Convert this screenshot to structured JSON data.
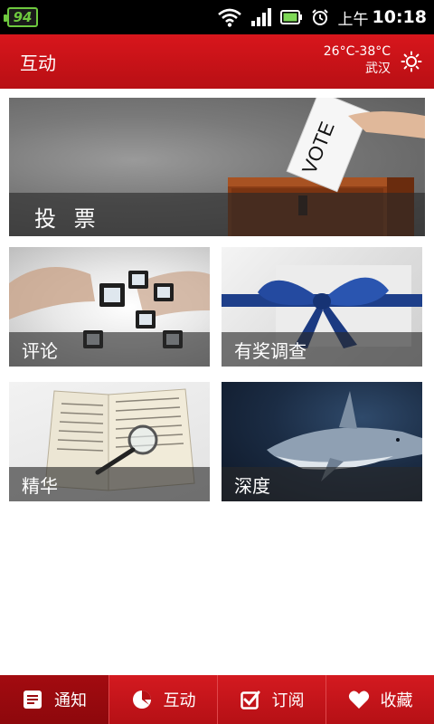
{
  "status_bar": {
    "battery_level": "94",
    "time_prefix": "上午",
    "time": "10:18",
    "icons": [
      "battery-charging-icon",
      "wifi-icon",
      "signal-icon",
      "battery-icon",
      "alarm-icon"
    ]
  },
  "header": {
    "title": "互动",
    "weather_temp": "26°C-38°C",
    "weather_city": "武汉",
    "settings_icon": "sun-settings-icon"
  },
  "tiles": [
    {
      "label": "投 票",
      "image": "ballot-box-photo"
    },
    {
      "label": "评论",
      "image": "slides-in-hands-photo"
    },
    {
      "label": "有奖调查",
      "image": "blue-ribbon-gift-photo"
    },
    {
      "label": "精华",
      "image": "book-magnifier-photo"
    },
    {
      "label": "深度",
      "image": "shark-underwater-photo"
    }
  ],
  "tabbar": {
    "active": "通知",
    "items": [
      {
        "label": "通知",
        "icon": "notice-icon"
      },
      {
        "label": "互动",
        "icon": "pie-chat-icon"
      },
      {
        "label": "订阅",
        "icon": "checkbox-icon"
      },
      {
        "label": "收藏",
        "icon": "heart-icon"
      }
    ]
  },
  "colors": {
    "brand_red": "#c8131a",
    "active_tab": "#9a090e",
    "status_green": "#6ec93e"
  }
}
